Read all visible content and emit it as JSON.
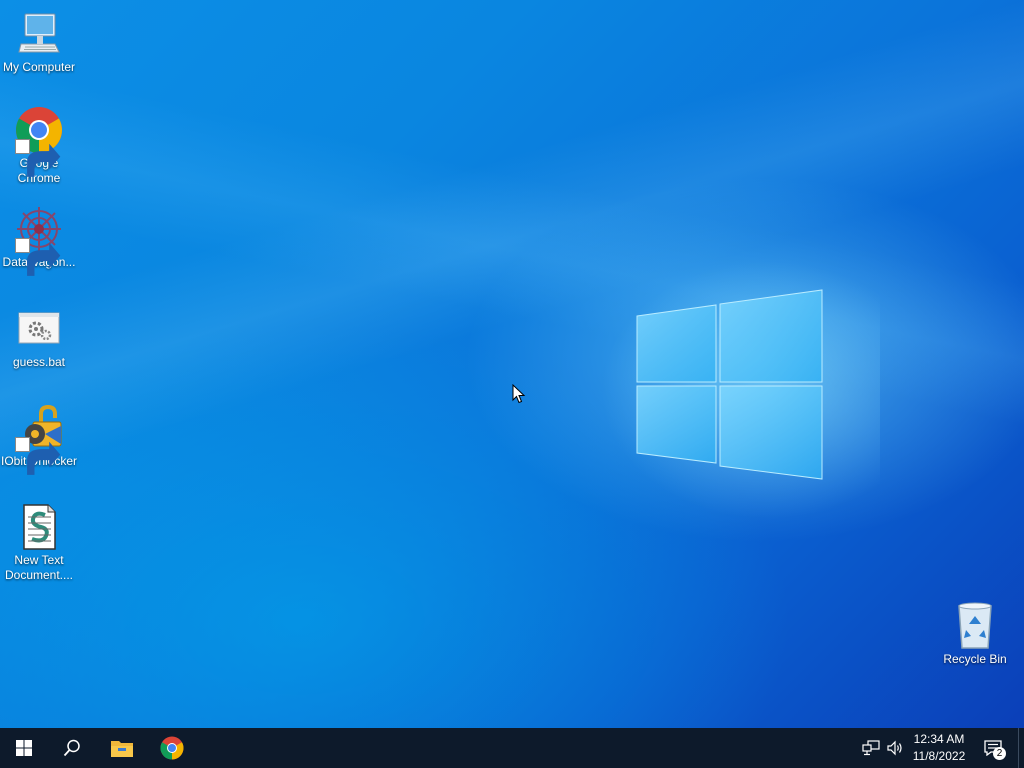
{
  "desktop": {
    "icons": [
      {
        "label": "My Computer",
        "icon": "monitor-icon"
      },
      {
        "label": "Google Chrome",
        "icon": "chrome-icon",
        "shortcut": true
      },
      {
        "label": "DataWagon...",
        "icon": "datawagon-icon",
        "shortcut": true
      },
      {
        "label": "guess.bat",
        "icon": "batch-file-icon"
      },
      {
        "label": "IObit Unlocker",
        "icon": "iobit-unlocker-icon",
        "shortcut": true
      },
      {
        "label": "New Text Document....",
        "icon": "text-document-icon"
      }
    ],
    "recycle_bin": {
      "label": "Recycle Bin",
      "icon": "recycle-bin-icon"
    }
  },
  "taskbar": {
    "start": {
      "icon": "windows-start-icon"
    },
    "search": {
      "icon": "search-icon"
    },
    "pinned": [
      {
        "name": "File Explorer",
        "icon": "file-explorer-icon"
      },
      {
        "name": "Google Chrome",
        "icon": "chrome-icon"
      }
    ],
    "tray": {
      "network_icon": "network-icon",
      "volume_icon": "volume-icon",
      "time": "12:34 AM",
      "date": "11/8/2022",
      "notifications_icon": "action-center-icon",
      "notification_count": "2"
    }
  },
  "colors": {
    "taskbar_bg": "#0d1a2b",
    "desktop_bg": "#0a7ee0",
    "text": "#ffffff"
  }
}
